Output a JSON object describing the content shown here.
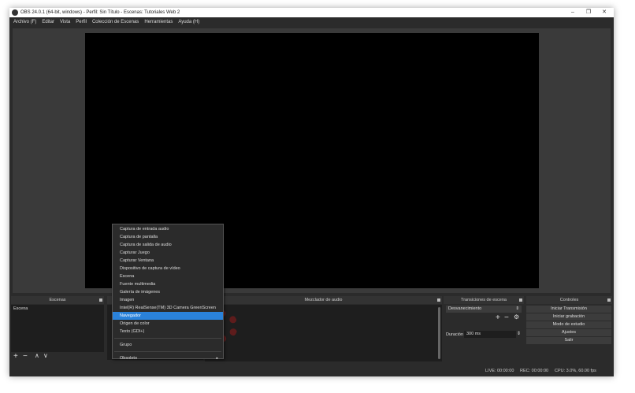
{
  "window": {
    "title": "OBS 24.0.1 (64-bit, windows) - Perfil: Sin Título - Escenas: Tutoriales Web 2",
    "minimize": "–",
    "restore": "❐",
    "close": "✕"
  },
  "menu": [
    "Archivo (F)",
    "Editar",
    "Vista",
    "Perfil",
    "Colección de Escenas",
    "Herramientas",
    "Ayuda (H)"
  ],
  "docks": {
    "scenes": {
      "title": "Escenas",
      "items": [
        "Escena"
      ],
      "toolbar": [
        "+",
        "−",
        "∧",
        "∨"
      ]
    },
    "mixer": {
      "title": "Mezclador de audio"
    },
    "transitions": {
      "title": "Transiciones de escena",
      "selected": "Desvanecimiento",
      "duration_label": "Duración",
      "duration_value": "300 ms",
      "toolbar": [
        "+",
        "−",
        "⚙"
      ]
    },
    "controls": {
      "title": "Controles",
      "buttons": [
        "Iniciar Transmisión",
        "Iniciar grabación",
        "Modo de estudio",
        "Ajustes",
        "Salir"
      ]
    }
  },
  "context_menu": {
    "items": [
      "Captura de entrada audio",
      "Captura de pantalla",
      "Captura de salida de audio",
      "Capturar Juego",
      "Capturar Ventana",
      "Dispositivo de captura de vídeo",
      "Escena",
      "Fuente multimedia",
      "Galería de imágenes",
      "Imagen",
      "Intel(R) RealSense(TM) 3D Camera GreenScreen",
      "Navegador",
      "Origen de color",
      "Texto (GDI+)"
    ],
    "group": "Grupo",
    "obsolete": "Obsoleto",
    "highlighted": "Navegador",
    "highlight_color": "#2a82da"
  },
  "status": {
    "live": "LIVE: 00:00:00",
    "rec": "REC: 00:00:00",
    "cpu": "CPU: 3.0%, 60.00 fps"
  }
}
